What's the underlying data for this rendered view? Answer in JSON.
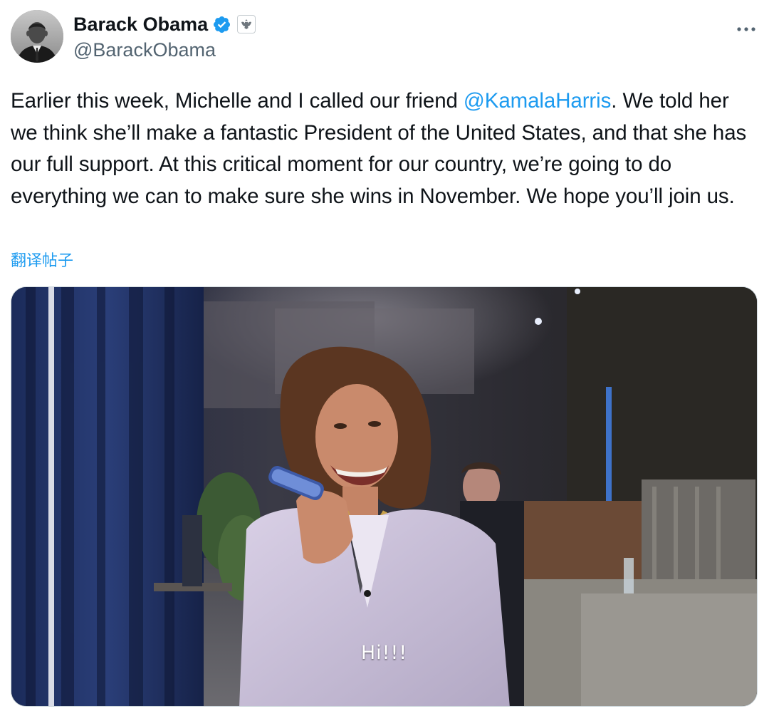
{
  "author": {
    "display_name": "Barack Obama",
    "handle": "@BarackObama",
    "avatar_icon": "profile-photo-icon",
    "verified_icon": "verified-badge-icon",
    "affiliation_icon": "government-seal-icon"
  },
  "more_icon": "more-options-icon",
  "tweet": {
    "text_before": "Earlier this week, Michelle and I called our friend ",
    "mention": "@KamalaHarris",
    "text_after": ". We told her we think she’ll make a fantastic President of the United States, and that she has our full support. At this critical moment for our country, we’re going to do everything we can to make sure she wins in November. We hope you’ll join us.",
    "translate_label": "翻译帖子"
  },
  "media": {
    "caption": "Hi!!!"
  },
  "colors": {
    "accent": "#1d9bf0",
    "text": "#0f1419",
    "secondary": "#536471"
  }
}
